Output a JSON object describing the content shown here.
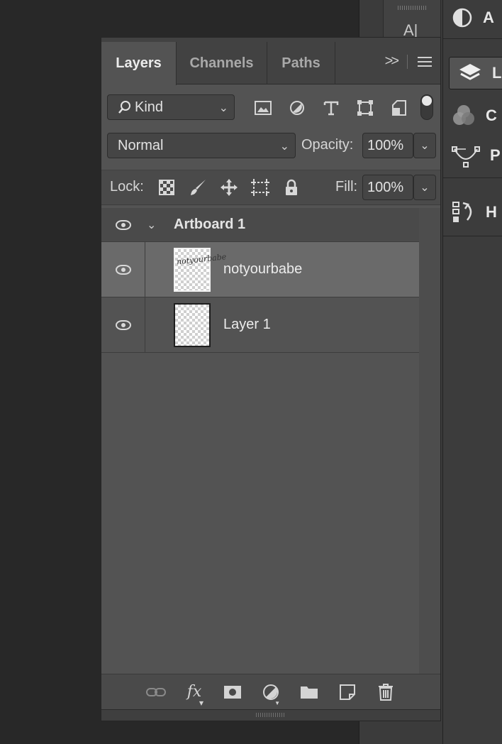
{
  "panel": {
    "tabs": [
      {
        "label": "Layers",
        "active": true
      },
      {
        "label": "Channels",
        "active": false
      },
      {
        "label": "Paths",
        "active": false
      }
    ],
    "collapse_glyph": ">>",
    "filter": {
      "kind_label": "Kind",
      "icons": [
        "image-filter-icon",
        "adjustment-filter-icon",
        "type-filter-icon",
        "shape-filter-icon",
        "smart-object-filter-icon"
      ]
    },
    "blend_mode": "Normal",
    "opacity_label": "Opacity:",
    "opacity_value": "100%",
    "lock_label": "Lock:",
    "lock_icons": [
      "lock-transparent-pixels-icon",
      "lock-image-pixels-icon",
      "lock-position-icon",
      "lock-artboard-icon",
      "lock-all-icon"
    ],
    "fill_label": "Fill:",
    "fill_value": "100%",
    "layers": [
      {
        "type": "artboard",
        "name": "Artboard 1",
        "visible": true,
        "expanded": true
      },
      {
        "type": "layer",
        "name": "notyourbabe",
        "visible": true,
        "selected": true,
        "thumb_text": "notyourbabe"
      },
      {
        "type": "layer",
        "name": "Layer 1",
        "visible": true,
        "selected": false
      }
    ],
    "bottom_icons": [
      "link-layers-icon",
      "fx-icon",
      "add-mask-icon",
      "adjustment-layer-icon",
      "group-folder-icon",
      "new-layer-icon",
      "delete-icon"
    ],
    "fx_label": "fx"
  },
  "dock": {
    "items": [
      {
        "icon": "adjustments-icon",
        "label": "A"
      },
      {
        "icon": "layers-icon",
        "label": "L",
        "active": true
      },
      {
        "icon": "channels-icon",
        "label": "C"
      },
      {
        "icon": "paths-icon",
        "label": "P"
      },
      {
        "icon": "history-icon",
        "label": "H"
      }
    ],
    "tool_glyph": "A|"
  }
}
